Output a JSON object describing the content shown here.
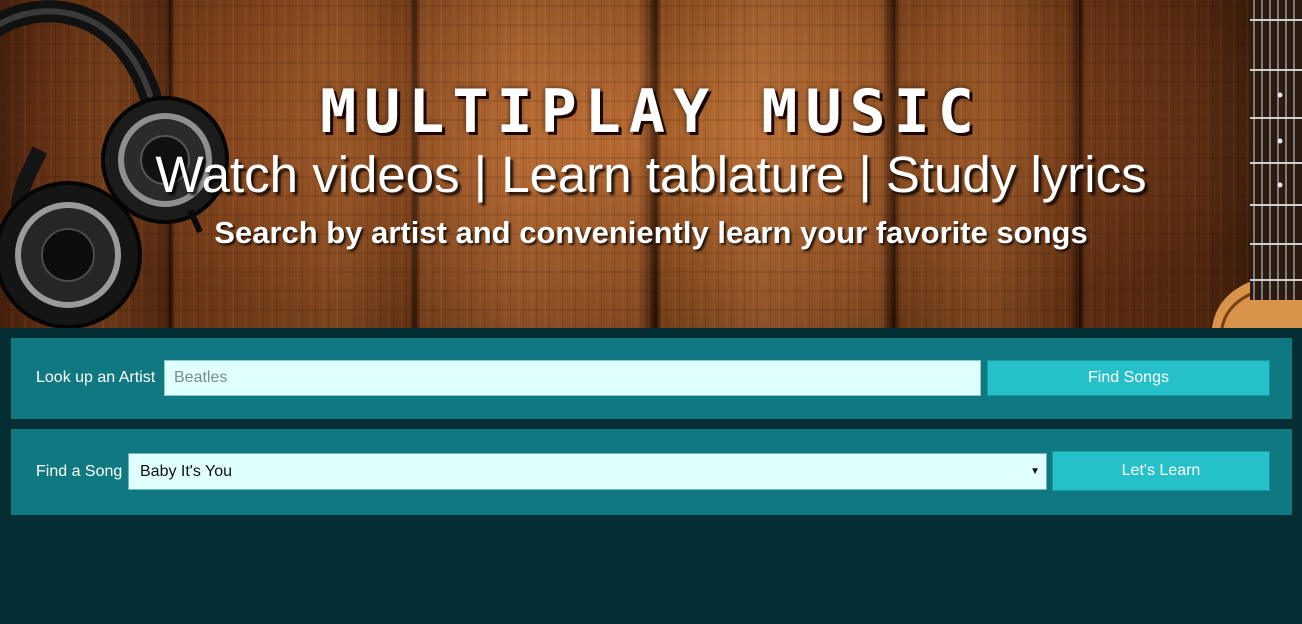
{
  "header": {
    "logo": "MULTIPLAY MUSIC",
    "tagline": "Watch videos | Learn tablature | Study lyrics",
    "subtagline": "Search by artist and conveniently learn your favorite songs",
    "decor": {
      "left_image": "headphones-icon",
      "right_image": "guitar-icon"
    }
  },
  "artist_search": {
    "label": "Look up an Artist",
    "placeholder": "Beatles",
    "value": "",
    "button_label": "Find Songs"
  },
  "song_finder": {
    "label": "Find a Song",
    "selected": "Baby It's You",
    "caret": "▼",
    "button_label": "Let's Learn"
  },
  "colors": {
    "page_bg": "#032e33",
    "panel_bg": "#0f7880",
    "input_bg": "#e0ffff",
    "button_bg": "#26c0c8",
    "text": "#ffffff"
  }
}
